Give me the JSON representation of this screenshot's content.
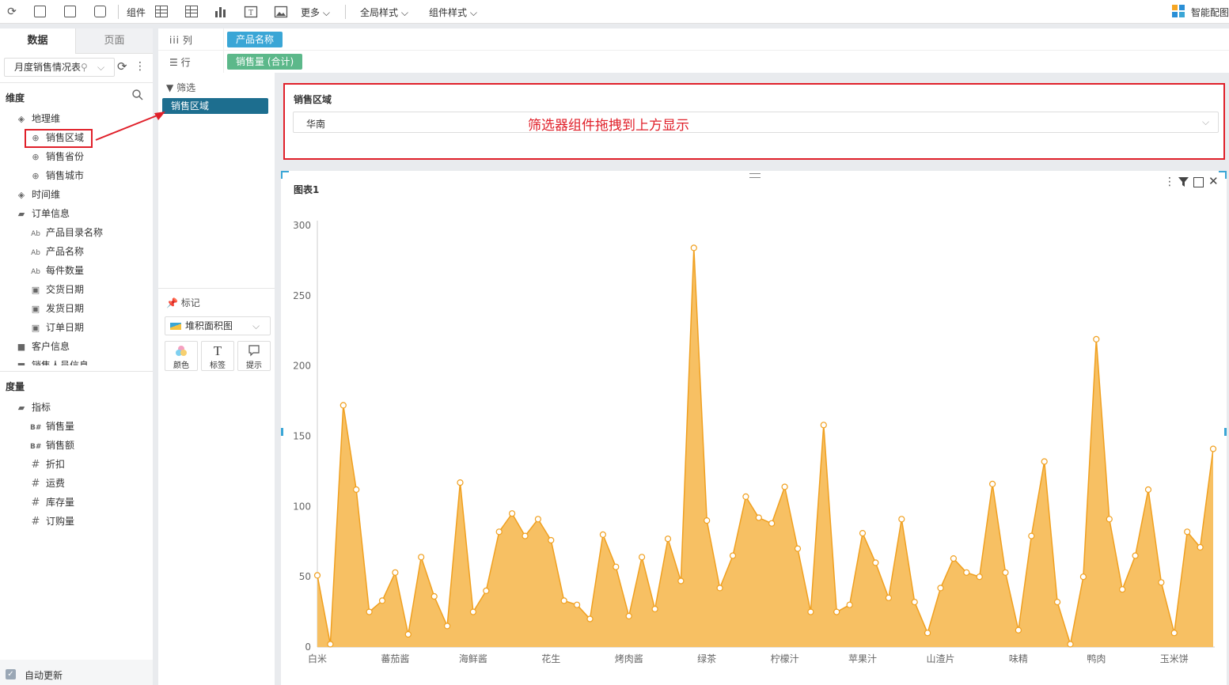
{
  "toolbar": {
    "component_label": "组件",
    "more_label": "更多",
    "global_style_label": "全局样式",
    "component_style_label": "组件样式",
    "smart_chart_label": "智能配图"
  },
  "left_panel": {
    "tabs": [
      "数据",
      "页面"
    ],
    "dataset_select": "月度销售情况表",
    "dimension_header": "维度",
    "dimension_items": [
      {
        "label": "地理维",
        "icon": "layers-icon",
        "level": 0
      },
      {
        "label": "销售区域",
        "icon": "globe-icon",
        "level": 1
      },
      {
        "label": "销售省份",
        "icon": "globe-icon",
        "level": 1
      },
      {
        "label": "销售城市",
        "icon": "globe-icon",
        "level": 1
      },
      {
        "label": "时间维",
        "icon": "layers-icon",
        "level": 0
      },
      {
        "label": "订单信息",
        "icon": "folder-open-icon",
        "level": 0
      },
      {
        "label": "产品目录名称",
        "icon": "text-field-icon",
        "level": 1
      },
      {
        "label": "产品名称",
        "icon": "text-field-icon",
        "level": 1
      },
      {
        "label": "每件数量",
        "icon": "text-field-icon",
        "level": 1
      },
      {
        "label": "交货日期",
        "icon": "calendar-icon",
        "level": 1
      },
      {
        "label": "发货日期",
        "icon": "calendar-icon",
        "level": 1
      },
      {
        "label": "订单日期",
        "icon": "calendar-icon",
        "level": 1
      },
      {
        "label": "客户信息",
        "icon": "folder-icon",
        "level": 0
      },
      {
        "label": "销售人员信息",
        "icon": "folder-icon",
        "level": 0
      }
    ],
    "measure_header": "度量",
    "measure_items": [
      {
        "label": "指标",
        "icon": "folder-open-icon",
        "level": 0
      },
      {
        "label": "销售量",
        "icon": "measure-icon",
        "glyph": "B#",
        "level": 1
      },
      {
        "label": "销售额",
        "icon": "measure-icon",
        "glyph": "B#",
        "level": 1
      },
      {
        "label": "折扣",
        "icon": "hash-icon",
        "glyph": "#",
        "level": 1
      },
      {
        "label": "运费",
        "icon": "hash-icon",
        "glyph": "#",
        "level": 1
      },
      {
        "label": "库存量",
        "icon": "hash-icon",
        "glyph": "#",
        "level": 1
      },
      {
        "label": "订购量",
        "icon": "hash-icon",
        "glyph": "#",
        "level": 1
      }
    ],
    "auto_update_label": "自动更新"
  },
  "shelves": {
    "column_label": "列",
    "row_label": "行",
    "column_pill": "产品名称",
    "row_pill": "销售量 (合计)",
    "column_pill_color": "#3aa6d6",
    "row_pill_color": "#5cb88a"
  },
  "mid_panel": {
    "filter_label": "筛选",
    "filter_pill": "销售区域",
    "filter_pill_color": "#1d6e8f",
    "marks_label": "标记",
    "chart_type": "堆积面积图",
    "mark_buttons": [
      "颜色",
      "标签",
      "提示"
    ]
  },
  "filter_widget": {
    "title": "销售区域",
    "selected": "华南",
    "annotation": "筛选器组件拖拽到上方显示",
    "highlight_color": "#e0202a"
  },
  "chart_data": {
    "type": "area",
    "title": "图表1",
    "ylim": [
      0,
      300
    ],
    "yticks": [
      0,
      50,
      100,
      150,
      200,
      250,
      300
    ],
    "x_tick_labels": [
      "白米",
      "蕃茄酱",
      "海鲜酱",
      "花生",
      "烤肉酱",
      "绿茶",
      "柠檬汁",
      "苹果汁",
      "山渣片",
      "味精",
      "鸭肉",
      "玉米饼"
    ],
    "color": "#f7c063",
    "line_color": "#f0a020",
    "values": [
      51,
      2,
      172,
      112,
      25,
      33,
      53,
      9,
      64,
      36,
      15,
      117,
      25,
      40,
      82,
      95,
      79,
      91,
      76,
      33,
      30,
      20,
      80,
      57,
      22,
      64,
      27,
      77,
      47,
      284,
      90,
      42,
      65,
      107,
      92,
      88,
      114,
      70,
      25,
      158,
      25,
      30,
      81,
      60,
      35,
      91,
      32,
      10,
      42,
      63,
      53,
      50,
      116,
      53,
      12,
      79,
      132,
      32,
      2,
      50,
      219,
      91,
      41,
      65,
      112,
      46,
      10,
      82,
      71,
      141
    ]
  }
}
